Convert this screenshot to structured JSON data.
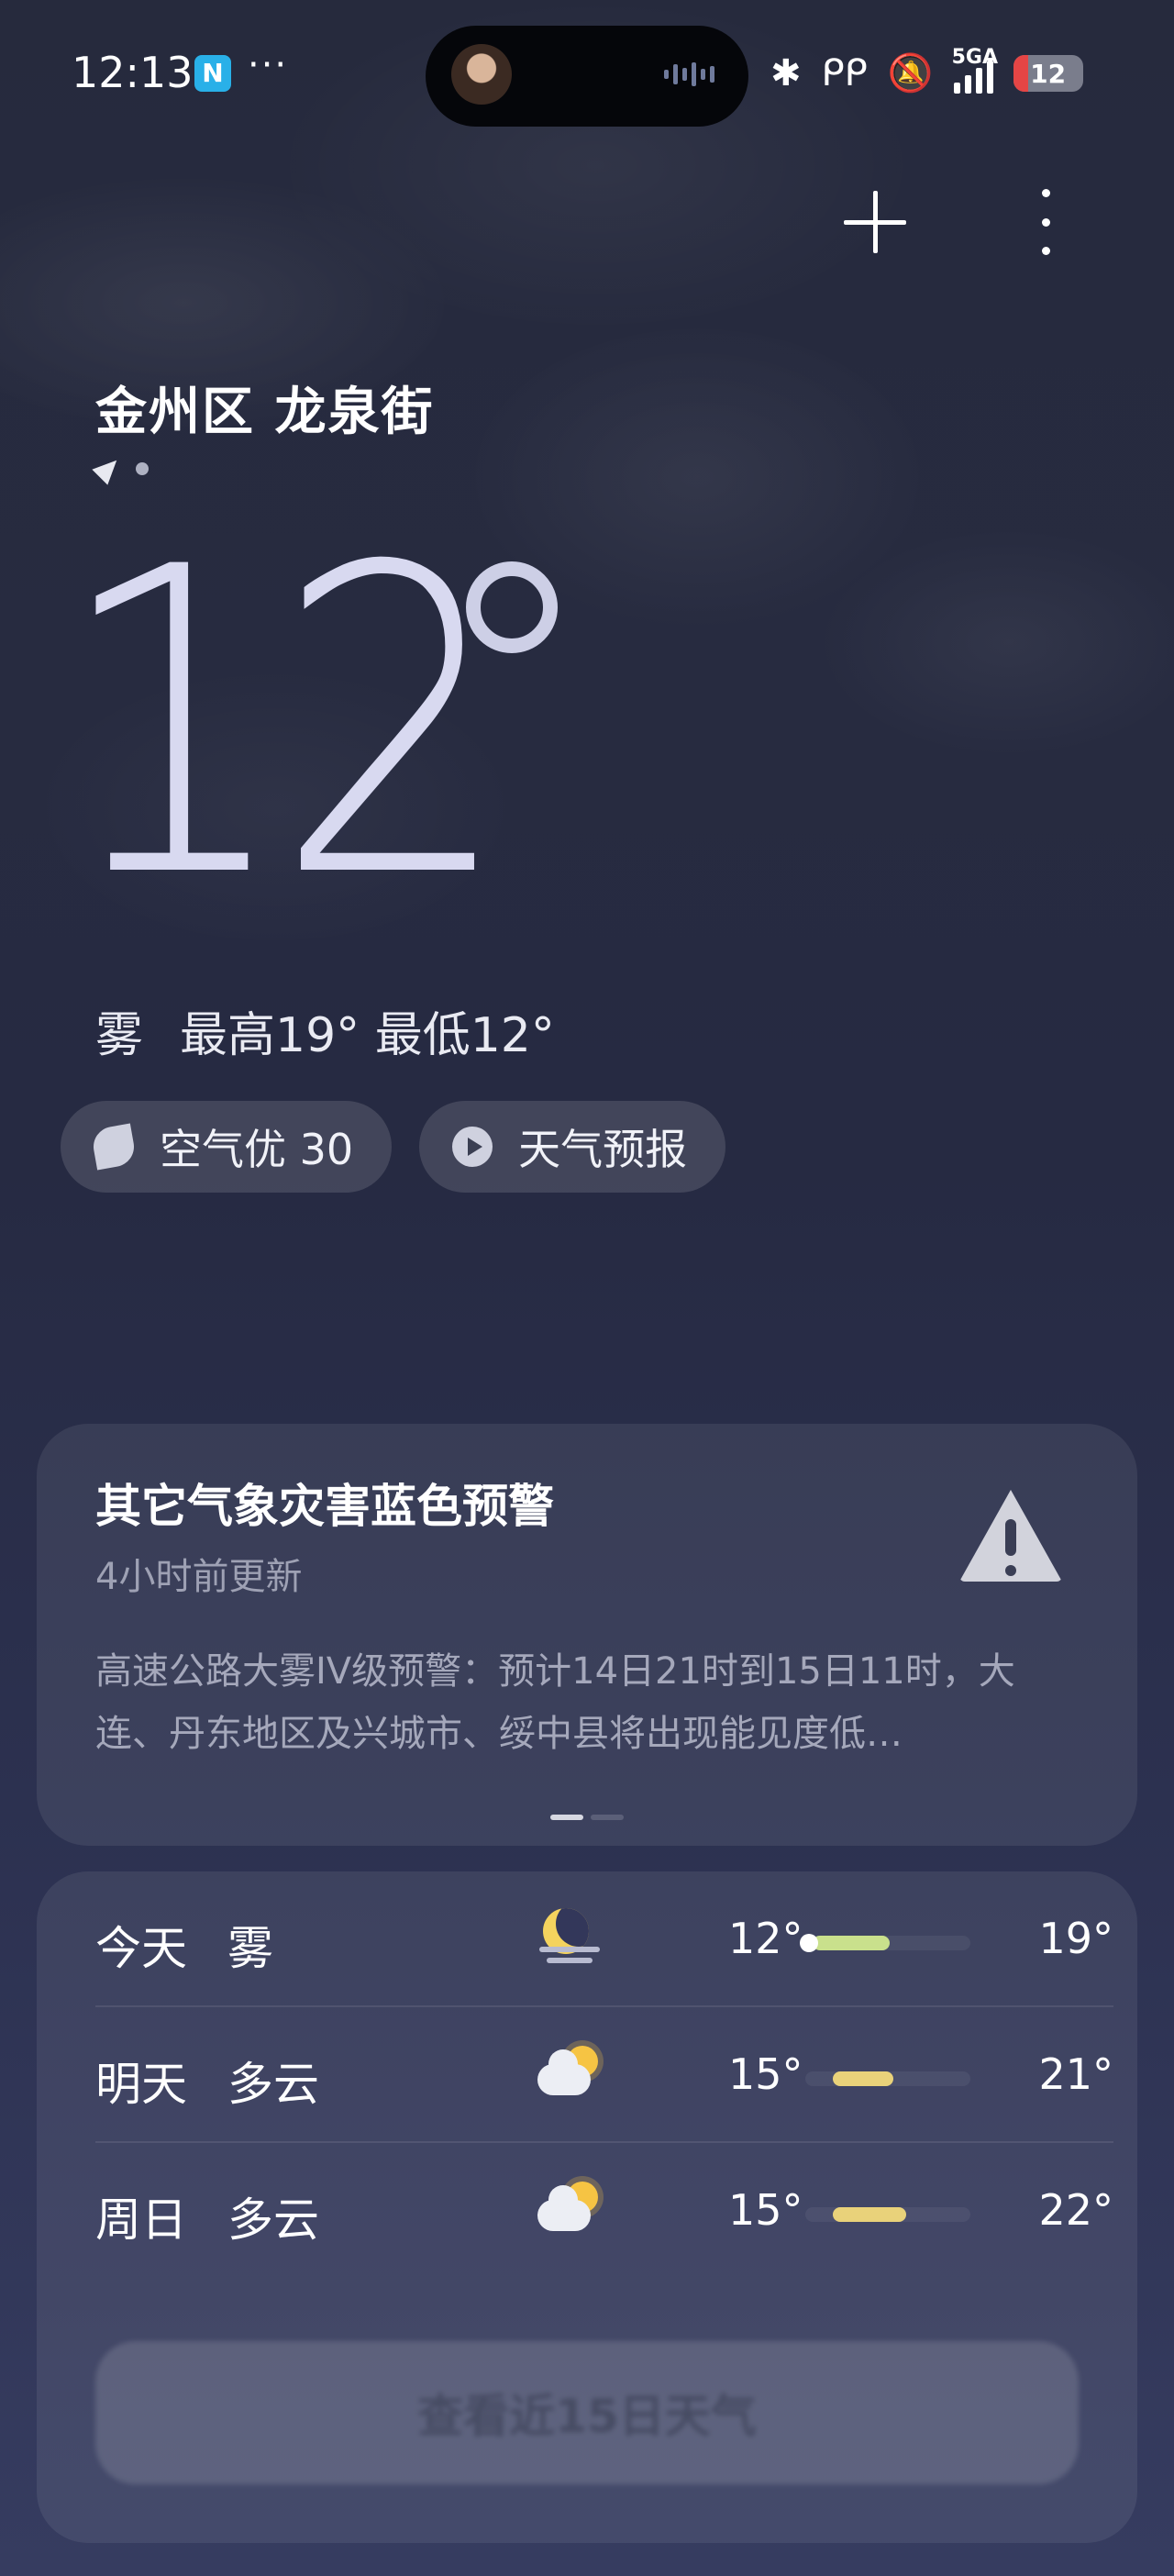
{
  "status_bar": {
    "time": "12:13",
    "nfc_label": "N",
    "more_dots": "···",
    "network_label": "5GA",
    "battery_level": "12"
  },
  "location": {
    "name": "金州区 龙泉街"
  },
  "current": {
    "temperature": "12",
    "condition": "雾",
    "high_low": "最高19° 最低12°"
  },
  "chips": {
    "air_quality": "空气优 30",
    "forecast_video": "天气预报"
  },
  "alert": {
    "title": "其它气象灾害蓝色预警",
    "updated": "4小时前更新",
    "body": "高速公路大雾IV级预警：预计14日21时到15日11时，大连、丹东地区及兴城市、绥中县将出现能见度低…"
  },
  "forecast": {
    "days": [
      {
        "day": "今天",
        "condition": "雾",
        "low": "12°",
        "high": "19°",
        "icon": "moon-fog-icon"
      },
      {
        "day": "明天",
        "condition": "多云",
        "low": "15°",
        "high": "21°",
        "icon": "partly-cloudy-icon"
      },
      {
        "day": "周日",
        "condition": "多云",
        "low": "15°",
        "high": "22°",
        "icon": "partly-cloudy-icon"
      }
    ],
    "more_button": "查看近15日天气"
  },
  "colors": {
    "today_bar": "#c9e08c",
    "tomorrow_bar": "#e9d27a",
    "sunday_bar": "#e9d27a"
  }
}
